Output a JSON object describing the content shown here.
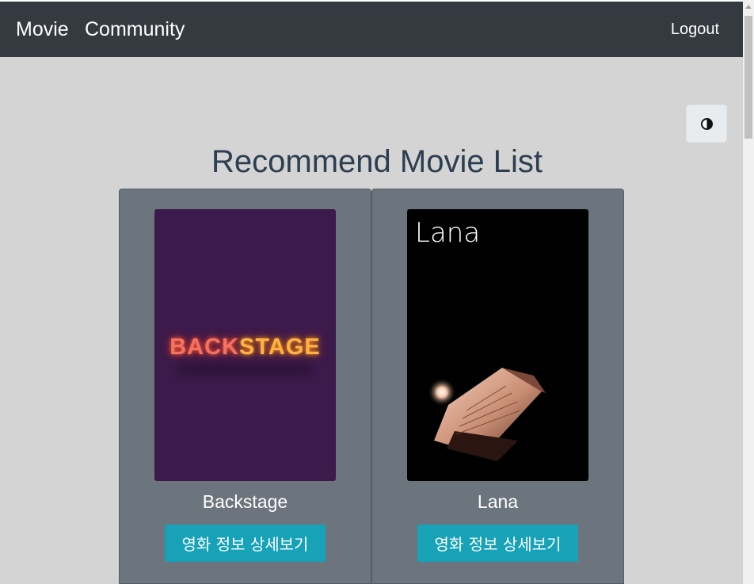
{
  "navbar": {
    "brand": "Movie",
    "community": "Community",
    "logout": "Logout",
    "background_color": "#343a40"
  },
  "theme_toggle": {
    "icon": "contrast-icon"
  },
  "main": {
    "title": "Recommend Movie List",
    "cards": [
      {
        "title": "Backstage",
        "poster_text_a": "BACK",
        "poster_text_b": "STAGE",
        "button_label": "영화 정보 상세보기"
      },
      {
        "title": "Lana",
        "poster_text": "Lana",
        "button_label": "영화 정보 상세보기"
      }
    ]
  },
  "colors": {
    "page_background": "#d4d4d4",
    "card_background": "#6c757d",
    "button_color": "#17a2b8",
    "title_color": "#2c3e50"
  }
}
